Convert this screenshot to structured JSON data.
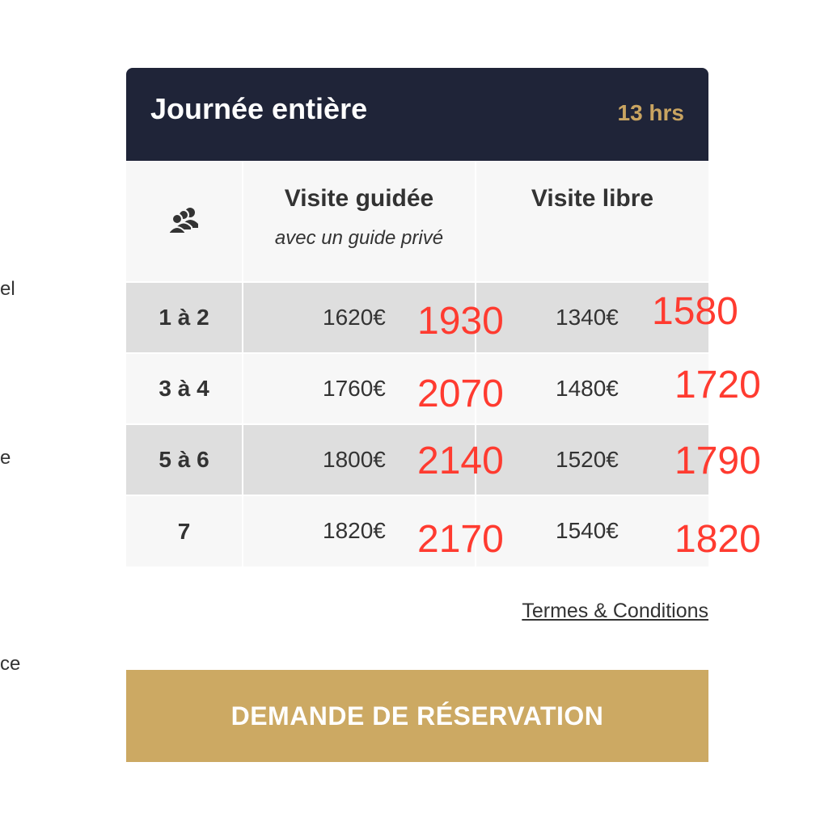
{
  "left_fragments": [
    "el",
    "e",
    "ce"
  ],
  "card": {
    "title": "Journée entière",
    "duration": "13 hrs"
  },
  "table": {
    "group_icon": "group-of-people-icon",
    "columns": [
      {
        "label": "Visite guidée",
        "sublabel": "avec un guide privé"
      },
      {
        "label": "Visite libre",
        "sublabel": ""
      }
    ],
    "rows": [
      {
        "group": "1 à 2",
        "guided": "1620€",
        "free": "1340€"
      },
      {
        "group": "3 à 4",
        "guided": "1760€",
        "free": "1480€"
      },
      {
        "group": "5 à 6",
        "guided": "1800€",
        "free": "1520€"
      },
      {
        "group": "7",
        "guided": "1820€",
        "free": "1540€"
      }
    ]
  },
  "annotations": {
    "guided": [
      "1930",
      "2070",
      "2140",
      "2170"
    ],
    "free": [
      "1580",
      "1720",
      "1790",
      "1820"
    ],
    "color": "#ff3b30"
  },
  "links": {
    "terms": "Termes & Conditions"
  },
  "cta": {
    "label": "DEMANDE DE RÉSERVATION",
    "color": "#cca963"
  },
  "colors": {
    "header_bg": "#1f2438",
    "accent_gold": "#c9a461",
    "row_dark": "#dedede",
    "row_light": "#f7f7f7"
  }
}
